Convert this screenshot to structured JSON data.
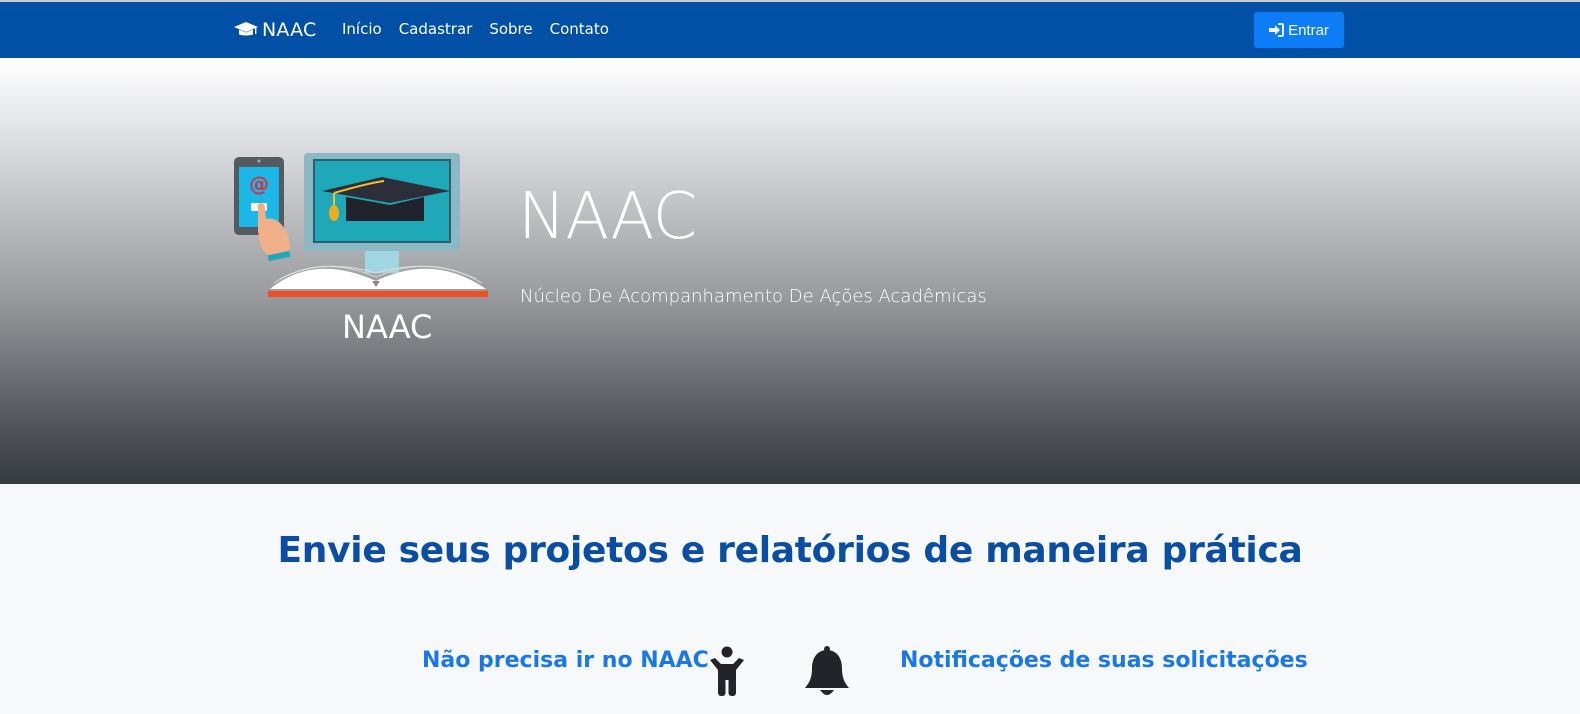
{
  "navbar": {
    "brand_icon": "graduation-cap-icon",
    "brand_text": "NAAC",
    "links": [
      "Início",
      "Cadastrar",
      "Sobre",
      "Contato"
    ],
    "login_icon": "sign-in-icon",
    "login_label": "Entrar",
    "background_color": "#0250a6",
    "login_color": "#0d7cf7"
  },
  "hero": {
    "logo_caption": "NAAC",
    "title": "NAAC",
    "subtitle": "Núcleo De Acompanhamento De Ações Acadêmicas"
  },
  "features": {
    "heading": "Envie seus projetos e relatórios de maneira prática",
    "left_text": "Não precisa ir no NAAC",
    "left_icon": "person-icon",
    "right_icon": "bell-icon",
    "right_text": "Notificações de suas solicitações",
    "heading_color": "#0a4ea3",
    "feature_color": "#1a78e6"
  }
}
